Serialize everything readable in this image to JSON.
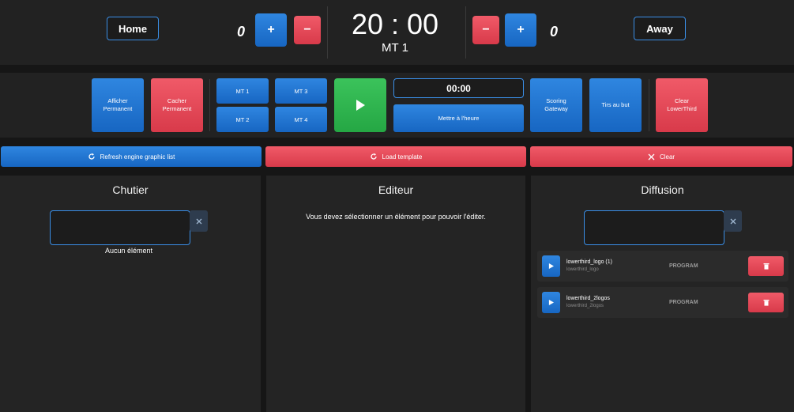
{
  "scoreboard": {
    "home_label": "Home",
    "away_label": "Away",
    "home_score": "0",
    "away_score": "0",
    "plus": "+",
    "minus": "−",
    "clock": "20 : 00",
    "period": "MT 1"
  },
  "controls": {
    "afficher": "Afficher\nPermanent",
    "cacher": "Cacher\nPermanent",
    "mt1": "MT 1",
    "mt2": "MT 2",
    "mt3": "MT 3",
    "mt4": "MT 4",
    "timer": "00:00",
    "mettre": "Mettre à l'heure",
    "scoring": "Scoring\nGateway",
    "tirs": "Tirs au but",
    "clear_lower": "Clear\nLowerThird"
  },
  "actions": {
    "refresh": "Refresh engine graphic list",
    "load": "Load template",
    "clear": "Clear"
  },
  "chutier": {
    "title": "Chutier",
    "empty": "Aucun élément"
  },
  "editeur": {
    "title": "Editeur",
    "message": "Vous devez sélectionner un élément pour pouvoir l'éditer."
  },
  "diffusion": {
    "title": "Diffusion",
    "items": [
      {
        "name": "lowerthird_logo (1)",
        "sub": "lowerthird_logo",
        "status": "PROGRAM"
      },
      {
        "name": "lowerthird_2logos",
        "sub": "lowerthird_2logos",
        "status": "PROGRAM"
      }
    ]
  },
  "colors": {
    "accent_blue": "#1f74d6",
    "accent_red": "#e24a59",
    "accent_green": "#2fb54f"
  }
}
